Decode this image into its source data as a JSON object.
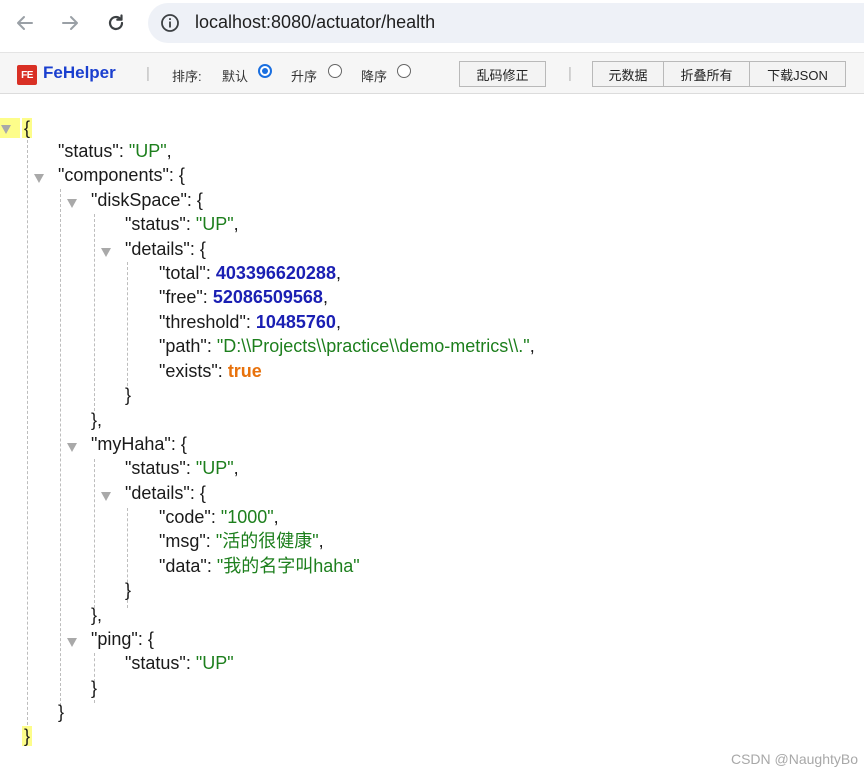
{
  "browser": {
    "url": "localhost:8080/actuator/health"
  },
  "fehelper": {
    "brand": "FeHelper",
    "logo_text": "FE",
    "separator": "|",
    "sort_label": "排序:",
    "sort_options": [
      {
        "label": "默认",
        "checked": true
      },
      {
        "label": "升序",
        "checked": false
      },
      {
        "label": "降序",
        "checked": false
      }
    ],
    "fix_encoding_button": "乱码修正",
    "meta_button": "元数据",
    "collapse_all_button": "折叠所有",
    "download_json_button": "下载JSON"
  },
  "json": {
    "root_open": "{",
    "root_close": "}",
    "status_key": "\"status\"",
    "status_value": "\"UP\"",
    "components_key": "\"components\"",
    "diskSpace": {
      "key": "\"diskSpace\"",
      "status_key": "\"status\"",
      "status_value": "\"UP\"",
      "details_key": "\"details\"",
      "total_key": "\"total\"",
      "total_value": "403396620288",
      "free_key": "\"free\"",
      "free_value": "52086509568",
      "threshold_key": "\"threshold\"",
      "threshold_value": "10485760",
      "path_key": "\"path\"",
      "path_value": "\"D:\\\\Projects\\\\practice\\\\demo-metrics\\\\.\"",
      "exists_key": "\"exists\"",
      "exists_value": "true"
    },
    "myHaha": {
      "key": "\"myHaha\"",
      "status_key": "\"status\"",
      "status_value": "\"UP\"",
      "details_key": "\"details\"",
      "code_key": "\"code\"",
      "code_value": "\"1000\"",
      "msg_key": "\"msg\"",
      "msg_value": "\"活的很健康\"",
      "data_key": "\"data\"",
      "data_value": "\"我的名字叫haha\""
    },
    "ping": {
      "key": "\"ping\"",
      "status_key": "\"status\"",
      "status_value": "\"UP\""
    }
  },
  "watermark": "CSDN @NaughtyBo",
  "colors": {
    "key": "#1a1a1a",
    "string": "#1d7f1d",
    "number": "#1a1fb3",
    "boolean": "#e8720c",
    "brand": "#1a3fcf",
    "highlight": "#fdfd8a"
  },
  "icons": [
    "back-arrow-icon",
    "forward-arrow-icon",
    "reload-icon",
    "site-info-icon",
    "collapse-triangle-icon"
  ]
}
